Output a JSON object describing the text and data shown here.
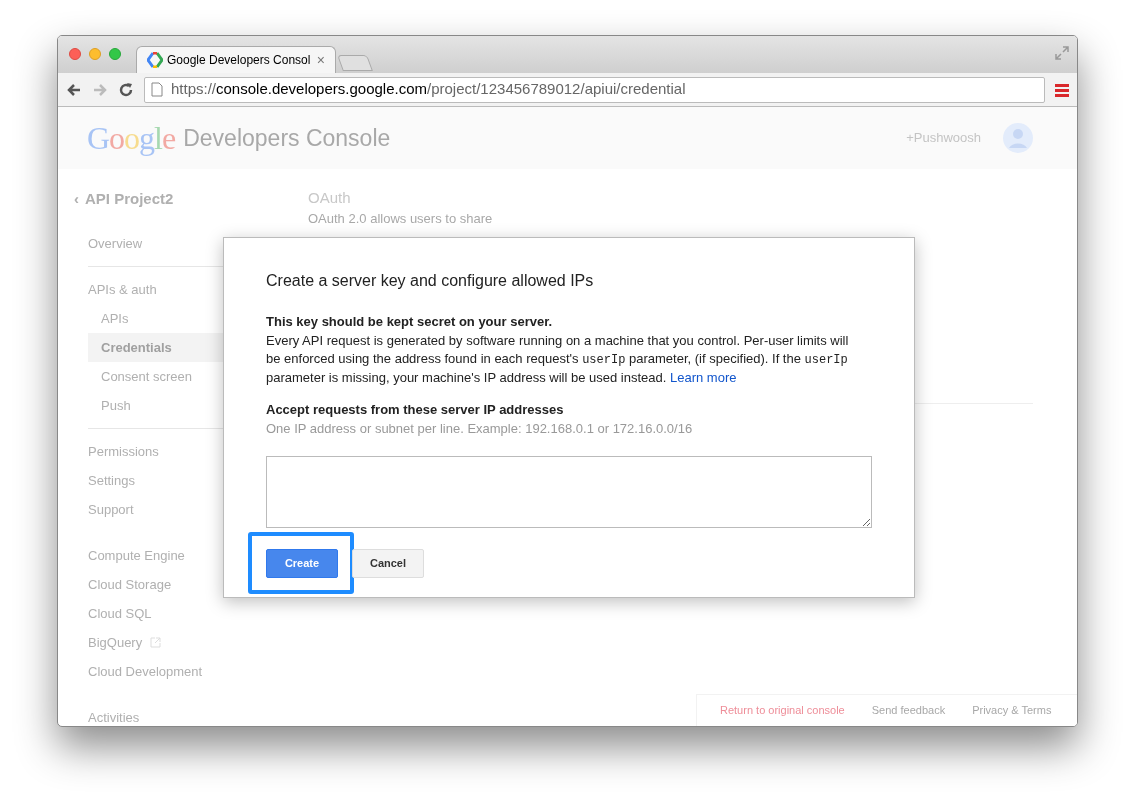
{
  "browser": {
    "tab": {
      "title": "Google Developers Consol",
      "close": "×",
      "selected": true
    },
    "url": {
      "scheme": "https://",
      "host": "console.developers.google.com",
      "path": "/project/123456789012/apiui/credential"
    },
    "forward_disabled": true
  },
  "header": {
    "logo": "Google",
    "product": "Developers Console",
    "account": "+Pushwoosh"
  },
  "sidebar": {
    "back": "‹",
    "project": "API Project2",
    "groups": [
      {
        "divider": true,
        "items": [
          {
            "label": "Overview",
            "kind": "item",
            "selected": false,
            "external": false
          }
        ]
      },
      {
        "divider": true,
        "items": [
          {
            "label": "APIs & auth",
            "kind": "section",
            "selected": false,
            "external": false
          },
          {
            "label": "APIs",
            "kind": "sub",
            "selected": false,
            "external": false
          },
          {
            "label": "Credentials",
            "kind": "sub",
            "selected": true,
            "external": false
          },
          {
            "label": "Consent screen",
            "kind": "sub",
            "selected": false,
            "external": false
          },
          {
            "label": "Push",
            "kind": "sub",
            "selected": false,
            "external": false
          }
        ]
      },
      {
        "divider": false,
        "items": [
          {
            "label": "Permissions",
            "kind": "item",
            "selected": false,
            "external": false
          },
          {
            "label": "Settings",
            "kind": "item",
            "selected": false,
            "external": false
          },
          {
            "label": "Support",
            "kind": "item",
            "selected": false,
            "external": false
          }
        ]
      },
      {
        "divider": false,
        "items": [
          {
            "label": "Compute Engine",
            "kind": "item",
            "selected": false,
            "external": false
          },
          {
            "label": "Cloud Storage",
            "kind": "item",
            "selected": false,
            "external": false
          },
          {
            "label": "Cloud SQL",
            "kind": "item",
            "selected": false,
            "external": false
          },
          {
            "label": "BigQuery",
            "kind": "item",
            "selected": false,
            "external": true
          },
          {
            "label": "Cloud Development",
            "kind": "item",
            "selected": false,
            "external": false
          }
        ]
      },
      {
        "items": [
          {
            "label": "Activities",
            "kind": "item",
            "selected": false,
            "external": false
          }
        ]
      }
    ]
  },
  "main": {
    "title": "OAuth",
    "description": [
      "OAuth 2.0 allows users to share"
    ]
  },
  "dialog": {
    "title": "Create a server key and configure allowed IPs",
    "warning": "This key should be kept secret on your server.",
    "paragraph": [
      {
        "kind": "text",
        "text": "Every API request is generated by software running on a machine that you control. Per-user limits will be enforced using the address found in each request's "
      },
      {
        "kind": "code",
        "text": "userIp"
      },
      {
        "kind": "text",
        "text": " parameter, (if specified). If the "
      },
      {
        "kind": "code",
        "text": "userIp"
      },
      {
        "kind": "text",
        "text": " parameter is missing, your machine's IP address will be used instead. "
      },
      {
        "kind": "link",
        "text": "Learn more"
      }
    ],
    "field_label": "Accept requests from these server IP addresses",
    "field_hint": "One IP address or subnet per line. Example: 192.168.0.1 or 172.16.0.0/16",
    "buttons": [
      {
        "label": "Create",
        "kind": "primary",
        "highlighted": true
      },
      {
        "label": "Cancel",
        "kind": "secondary",
        "highlighted": false
      }
    ]
  },
  "footer": [
    {
      "label": "Return to original console",
      "kind": "accent"
    },
    {
      "label": "Send feedback",
      "kind": "plain"
    },
    {
      "label": "Privacy & Terms",
      "kind": "plain"
    }
  ]
}
